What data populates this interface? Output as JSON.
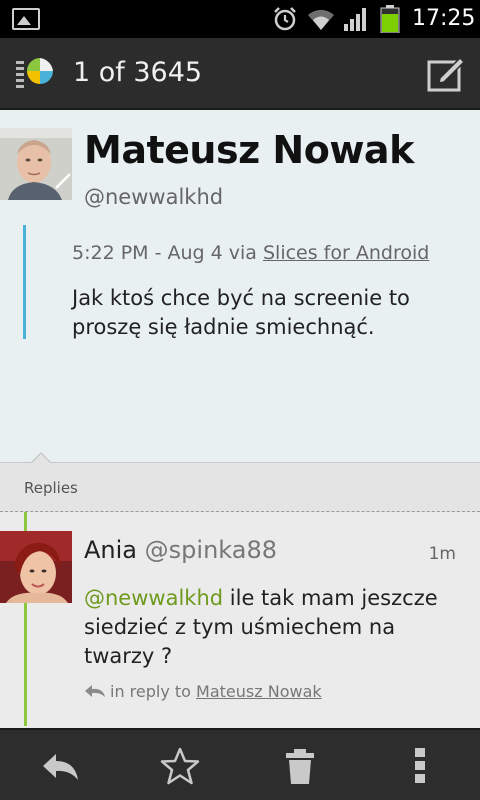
{
  "status_bar": {
    "time": "17:25",
    "icons": [
      "gallery-icon",
      "alarm-icon",
      "wifi-icon",
      "signal-icon",
      "battery-icon"
    ],
    "battery_color": "#7ccf00"
  },
  "action_bar": {
    "logo_icon": "slices-logo-icon",
    "title": "1 of 3645",
    "compose_icon": "compose-icon"
  },
  "tweet": {
    "name": "Mateusz Nowak",
    "handle": "@newwalkhd",
    "time": "5:22 PM",
    "date_prefix": " - Aug 4 via ",
    "via": "Slices for Android",
    "text": "Jak ktoś chce być na screenie to proszę się ładnie smiechnąć.",
    "accent_color": "#4ab1d9"
  },
  "replies": {
    "header": "Replies",
    "items": [
      {
        "name": "Ania",
        "handle": "@spinka88",
        "age": "1m",
        "mention": "@newwalkhd",
        "text": " ile tak mam jeszcze siedzieć z tym uśmiechem na twarzy ?",
        "in_reply_prefix": "in reply to ",
        "in_reply_to": "Mateusz Nowak",
        "accent_color": "#8dc63f"
      }
    ]
  },
  "bottom_bar": {
    "icons": [
      "reply-icon",
      "star-icon",
      "trash-icon",
      "overflow-menu-icon"
    ]
  }
}
